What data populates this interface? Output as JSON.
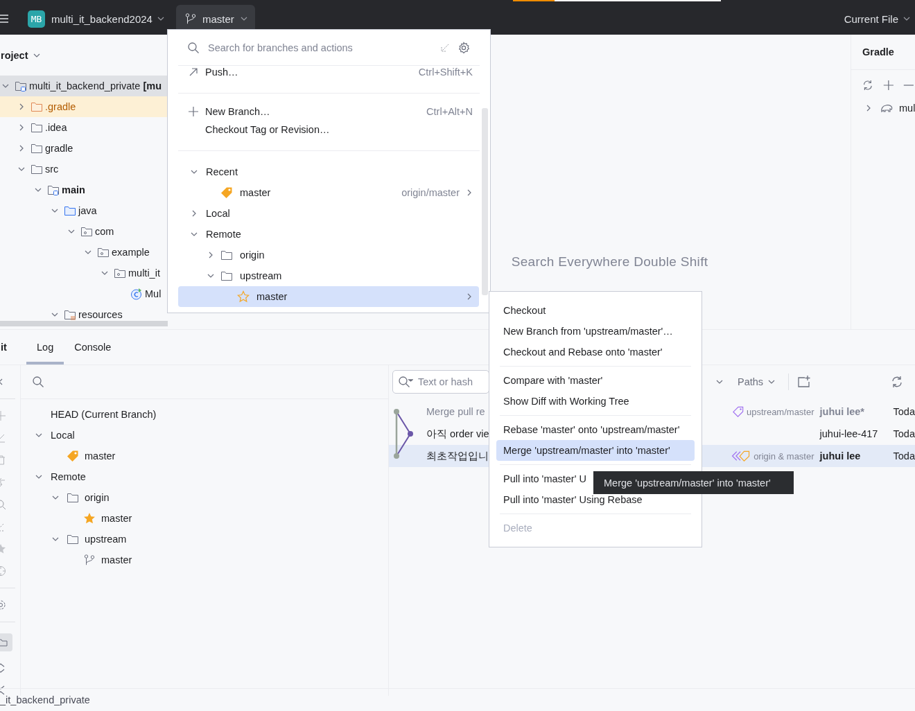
{
  "top_bar": {
    "progress": {
      "level": 0.2
    },
    "project_badge": "MB",
    "project_name": "multi_it_backend2024",
    "branch": "master",
    "run_config": "Current File"
  },
  "project_panel": {
    "title": "roject",
    "tree": [
      {
        "label": "multi_it_backend_private **[mu**",
        "kind": "module",
        "expanded": true,
        "selected": true,
        "children": [
          {
            "label": ".gradle",
            "kind": "excluded",
            "expanded": false,
            "selected": false
          },
          {
            "label": ".idea",
            "kind": "folder",
            "expanded": false,
            "selected": false
          },
          {
            "label": "gradle",
            "kind": "folder",
            "expanded": false,
            "selected": false
          },
          {
            "label": "src",
            "kind": "folder",
            "expanded": true,
            "selected": false,
            "children": [
              {
                "label": "main",
                "kind": "module",
                "bold": true,
                "expanded": true,
                "selected": false,
                "children": [
                  {
                    "label": "java",
                    "kind": "source",
                    "expanded": true,
                    "selected": false,
                    "children": [
                      {
                        "label": "com",
                        "kind": "package",
                        "expanded": true,
                        "selected": false,
                        "children": [
                          {
                            "label": "example",
                            "kind": "package",
                            "expanded": true,
                            "selected": false,
                            "children": [
                              {
                                "label": "multi_it",
                                "kind": "package",
                                "expanded": true,
                                "selected": false,
                                "children": [
                                  {
                                    "label": "Mul",
                                    "kind": "class",
                                    "selected": false
                                  }
                                ]
                              }
                            ]
                          }
                        ]
                      }
                    ]
                  },
                  {
                    "label": "resources",
                    "kind": "resources",
                    "expanded": true,
                    "selected": false
                  }
                ]
              }
            ]
          }
        ]
      }
    ]
  },
  "editor": {
    "hint": "Search Everywhere Double Shift"
  },
  "gradle_panel": {
    "title": "Gradle",
    "tree": [
      {
        "label": "mul",
        "expanded": false
      }
    ]
  },
  "git": {
    "title": "it",
    "tabs": [
      {
        "label": "Log",
        "selected": true
      },
      {
        "label": "Console",
        "selected": false
      }
    ],
    "branches": [
      {
        "label": "HEAD (Current Branch)"
      },
      {
        "label": "Local",
        "expanded": true,
        "children": [
          {
            "label": "master",
            "kind": "current"
          }
        ]
      },
      {
        "label": "Remote",
        "expanded": true,
        "children": [
          {
            "label": "origin",
            "kind": "folder",
            "expanded": true,
            "children": [
              {
                "label": "master",
                "kind": "favorite"
              }
            ]
          },
          {
            "label": "upstream",
            "kind": "folder",
            "expanded": true,
            "children": [
              {
                "label": "master",
                "kind": "branch"
              }
            ]
          }
        ]
      }
    ],
    "log": {
      "search_placeholder": "Text or hash",
      "filter": "Paths",
      "rows": [
        {
          "subject": "Merge pull re",
          "dimmed": true,
          "refs": {
            "label": "upstream/master",
            "kind": "remote"
          },
          "author": "juhui lee*",
          "author_bold": true,
          "date": "Toda",
          "selected": false
        },
        {
          "subject": "아직 order vie",
          "dimmed": false,
          "author": "juhui-lee-417",
          "author_bold": false,
          "date": "Toda",
          "selected": false
        },
        {
          "subject": "최초작업입니",
          "dimmed": false,
          "refs": {
            "label": "origin & master",
            "kind": "multi"
          },
          "author": "juhui lee",
          "author_bold": true,
          "date": "Toda",
          "selected": true
        }
      ]
    }
  },
  "branch_popup": {
    "search_placeholder": "Search for branches and actions",
    "action_groups": [
      [
        {
          "label": "Push…",
          "shortcut": "Ctrl+Shift+K",
          "kind": "push"
        }
      ],
      [
        {
          "label": "New Branch…",
          "shortcut": "Ctrl+Alt+N",
          "kind": "new"
        },
        {
          "label": "Checkout Tag or Revision…"
        }
      ]
    ],
    "tree": [
      {
        "label": "Recent",
        "expanded": true,
        "selected": false,
        "children": [
          {
            "label": "master",
            "kind": "current",
            "tracking": "origin/master",
            "submenu": true,
            "selected": false
          }
        ]
      },
      {
        "label": "Local",
        "expanded": false,
        "selected": false
      },
      {
        "label": "Remote",
        "expanded": true,
        "selected": false,
        "children": [
          {
            "label": "origin",
            "kind": "folder",
            "expanded": false,
            "selected": false
          },
          {
            "label": "upstream",
            "kind": "folder",
            "expanded": true,
            "selected": false,
            "children": [
              {
                "label": "master",
                "kind": "favorite-outline",
                "submenu": true,
                "selected": true
              }
            ]
          }
        ]
      }
    ]
  },
  "context_menu": {
    "groups": [
      [
        {
          "label": "Checkout",
          "disabled": false,
          "selected": false
        },
        {
          "label": "New Branch from 'upstream/master'…",
          "disabled": false,
          "selected": false
        },
        {
          "label": "Checkout and Rebase onto 'master'",
          "disabled": false,
          "selected": false
        }
      ],
      [
        {
          "label": "Compare with 'master'",
          "disabled": false,
          "selected": false
        },
        {
          "label": "Show Diff with Working Tree",
          "disabled": false,
          "selected": false
        }
      ],
      [
        {
          "label": "Rebase 'master' onto 'upstream/master'",
          "disabled": false,
          "selected": false
        },
        {
          "label": "Merge 'upstream/master' into 'master'",
          "disabled": false,
          "selected": true
        }
      ],
      [
        {
          "label": "Pull into 'master' U",
          "disabled": false,
          "selected": false
        },
        {
          "label": "Pull into 'master' Using Rebase",
          "disabled": false,
          "selected": false
        }
      ],
      [
        {
          "label": "Delete",
          "disabled": true,
          "selected": false
        }
      ]
    ]
  },
  "tooltip": {
    "text": "Merge 'upstream/master' into 'master'"
  },
  "status_bar": {
    "path": "_it_backend_private"
  }
}
